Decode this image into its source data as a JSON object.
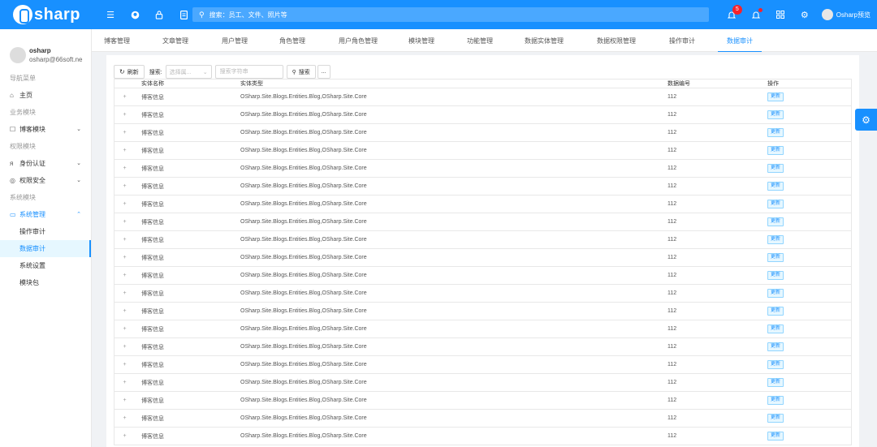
{
  "header": {
    "logo_text": "sharp",
    "search_placeholder": "搜索：员工、文件、照片等",
    "notice_count": "5",
    "username": "Osharp预览"
  },
  "sidebar": {
    "profile": {
      "name": "osharp",
      "email": "osharp@66soft.ne"
    },
    "groups": {
      "nav": "导航菜单",
      "business": "业务模块",
      "permission": "权限模块",
      "system": "系统模块"
    },
    "items": {
      "home": "主页",
      "blog": "博客模块",
      "identity": "身份认证",
      "security": "权限安全",
      "system": "系统管理"
    },
    "sub_items": [
      "操作审计",
      "数据审计",
      "系统设置",
      "模块包"
    ]
  },
  "tabs": [
    "博客管理",
    "文章管理",
    "用户管理",
    "角色管理",
    "用户角色管理",
    "模块管理",
    "功能管理",
    "数据实体管理",
    "数据权限管理",
    "操作审计",
    "数据审计"
  ],
  "toolbar": {
    "refresh": "刷新",
    "search_label": "搜索:",
    "select_placeholder": "选择属...",
    "keyword_placeholder": "搜索字符串",
    "search_button": "搜索",
    "more": "..."
  },
  "grid": {
    "columns": {
      "name": "实体名称",
      "type": "实体类型",
      "key": "数据编号",
      "op": "操作"
    },
    "update_label": "更新",
    "rows": [
      {
        "name": "博客信息",
        "type": "OSharp.Site.Blogs.Entities.Blog,OSharp.Site.Core",
        "key": "112"
      },
      {
        "name": "博客信息",
        "type": "OSharp.Site.Blogs.Entities.Blog,OSharp.Site.Core",
        "key": "112"
      },
      {
        "name": "博客信息",
        "type": "OSharp.Site.Blogs.Entities.Blog,OSharp.Site.Core",
        "key": "112"
      },
      {
        "name": "博客信息",
        "type": "OSharp.Site.Blogs.Entities.Blog,OSharp.Site.Core",
        "key": "112"
      },
      {
        "name": "博客信息",
        "type": "OSharp.Site.Blogs.Entities.Blog,OSharp.Site.Core",
        "key": "112"
      },
      {
        "name": "博客信息",
        "type": "OSharp.Site.Blogs.Entities.Blog,OSharp.Site.Core",
        "key": "112"
      },
      {
        "name": "博客信息",
        "type": "OSharp.Site.Blogs.Entities.Blog,OSharp.Site.Core",
        "key": "112"
      },
      {
        "name": "博客信息",
        "type": "OSharp.Site.Blogs.Entities.Blog,OSharp.Site.Core",
        "key": "112"
      },
      {
        "name": "博客信息",
        "type": "OSharp.Site.Blogs.Entities.Blog,OSharp.Site.Core",
        "key": "112"
      },
      {
        "name": "博客信息",
        "type": "OSharp.Site.Blogs.Entities.Blog,OSharp.Site.Core",
        "key": "112"
      },
      {
        "name": "博客信息",
        "type": "OSharp.Site.Blogs.Entities.Blog,OSharp.Site.Core",
        "key": "112"
      },
      {
        "name": "博客信息",
        "type": "OSharp.Site.Blogs.Entities.Blog,OSharp.Site.Core",
        "key": "112"
      },
      {
        "name": "博客信息",
        "type": "OSharp.Site.Blogs.Entities.Blog,OSharp.Site.Core",
        "key": "112"
      },
      {
        "name": "博客信息",
        "type": "OSharp.Site.Blogs.Entities.Blog,OSharp.Site.Core",
        "key": "112"
      },
      {
        "name": "博客信息",
        "type": "OSharp.Site.Blogs.Entities.Blog,OSharp.Site.Core",
        "key": "112"
      },
      {
        "name": "博客信息",
        "type": "OSharp.Site.Blogs.Entities.Blog,OSharp.Site.Core",
        "key": "112"
      },
      {
        "name": "博客信息",
        "type": "OSharp.Site.Blogs.Entities.Blog,OSharp.Site.Core",
        "key": "112"
      },
      {
        "name": "博客信息",
        "type": "OSharp.Site.Blogs.Entities.Blog,OSharp.Site.Core",
        "key": "112"
      },
      {
        "name": "博客信息",
        "type": "OSharp.Site.Blogs.Entities.Blog,OSharp.Site.Core",
        "key": "112"
      },
      {
        "name": "博客信息",
        "type": "OSharp.Site.Blogs.Entities.Blog,OSharp.Site.Core",
        "key": "112"
      }
    ]
  },
  "colors": {
    "primary": "#1890ff",
    "badge": "#f5222d"
  }
}
